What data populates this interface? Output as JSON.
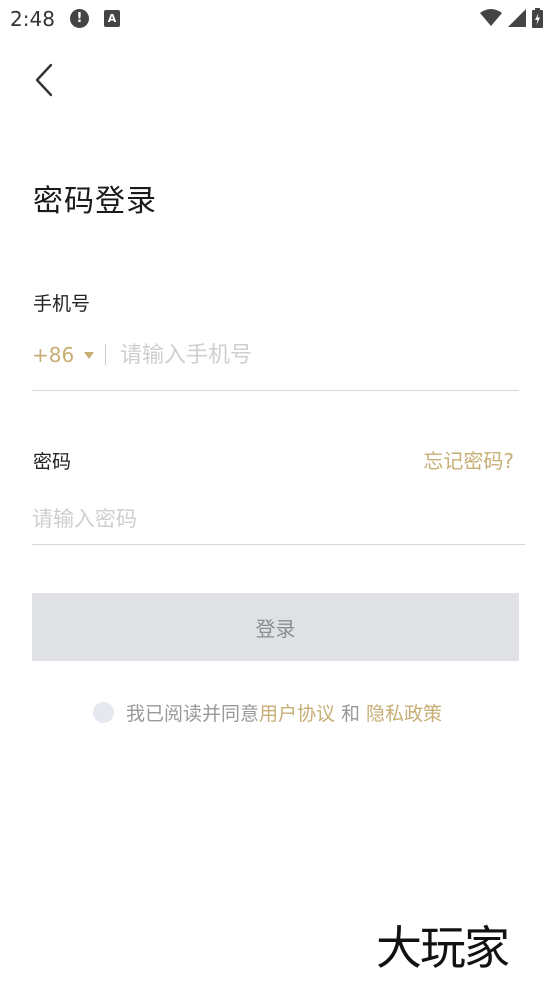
{
  "status_bar": {
    "time": "2:48",
    "alert_glyph": "!",
    "keyboard_glyph": "A",
    "icons": [
      "alert-icon",
      "keyboard-icon",
      "wifi-icon",
      "signal-icon",
      "battery-icon"
    ]
  },
  "header": {
    "back_icon": "chevron-left-icon",
    "title": "密码登录"
  },
  "phone": {
    "label": "手机号",
    "country_code": "+86",
    "placeholder": "请输入手机号",
    "value": ""
  },
  "password": {
    "label": "密码",
    "forgot_label": "忘记密码?",
    "placeholder": "请输入密码",
    "value": ""
  },
  "login": {
    "label": "登录"
  },
  "agreement": {
    "prefix": "我已阅读并同意",
    "user_agreement": "用户协议",
    "conjunction": "和",
    "privacy_policy": "隐私政策",
    "checked": false
  },
  "watermark": {
    "text": "大玩家"
  },
  "colors": {
    "accent": "#c7ae74",
    "button_bg": "#dfe1e5",
    "button_text": "#8a8d92",
    "placeholder": "#cfcfcf",
    "divider": "#d6d6d6"
  }
}
